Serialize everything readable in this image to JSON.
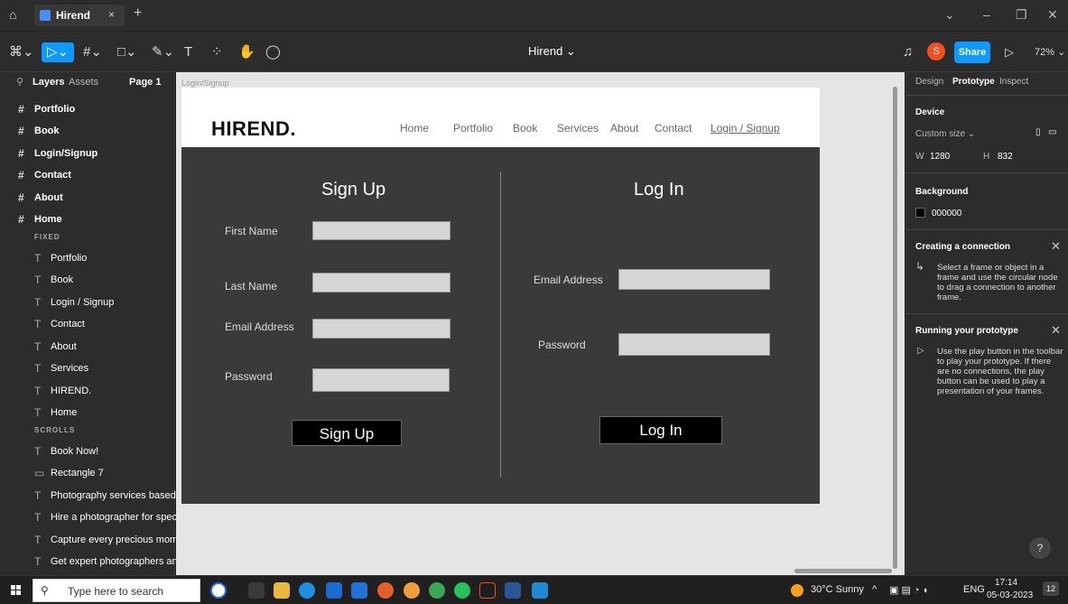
{
  "titlebar": {
    "tab_label": "Hirend",
    "tab_close": "×",
    "new_tab": "+",
    "min": "–",
    "restore": "❐",
    "close": "✕"
  },
  "toolbar": {
    "file_name": "Hirend",
    "file_caret": "⌄",
    "avatar_initial": "S",
    "share_label": "Share",
    "zoom": "72%"
  },
  "left_panel": {
    "tab_layers": "Layers",
    "tab_assets": "Assets",
    "page_label": "Page 1",
    "frames": [
      {
        "label": "Portfolio"
      },
      {
        "label": "Book"
      },
      {
        "label": "Login/Signup"
      },
      {
        "label": "Contact"
      },
      {
        "label": "About"
      },
      {
        "label": "Home"
      }
    ],
    "section_fixed": "FIXED",
    "fixed_items": [
      {
        "label": "Portfolio"
      },
      {
        "label": "Book"
      },
      {
        "label": "Login / Signup"
      },
      {
        "label": "Contact"
      },
      {
        "label": "About"
      },
      {
        "label": "Services"
      },
      {
        "label": "HIREND."
      },
      {
        "label": "Home"
      }
    ],
    "section_scrolls": "SCROLLS",
    "scroll_items": [
      {
        "label": "Book Now!"
      },
      {
        "label": "Rectangle 7"
      },
      {
        "label": "Photography services based ..."
      },
      {
        "label": "Hire a photographer for speci..."
      },
      {
        "label": "Capture every precious mome..."
      },
      {
        "label": "Get expert photographers an..."
      }
    ]
  },
  "canvas": {
    "frame_label": "Login/Signup",
    "site": {
      "logo": "HIREND.",
      "nav": [
        "Home",
        "Portfolio",
        "Book",
        "Services",
        "About",
        "Contact",
        "Login / Signup"
      ],
      "signup": {
        "heading": "Sign Up",
        "first_name": "First Name",
        "last_name": "Last Name",
        "email": "Email Address",
        "password": "Password",
        "button": "Sign Up"
      },
      "login": {
        "heading": "Log In",
        "email": "Email Address",
        "password": "Password",
        "button": "Log In"
      }
    }
  },
  "right_panel": {
    "tab_design": "Design",
    "tab_prototype": "Prototype",
    "tab_inspect": "Inspect",
    "device_heading": "Device",
    "device_value": "Custom size",
    "w_label": "W",
    "w_value": "1280",
    "h_label": "H",
    "h_value": "832",
    "background_heading": "Background",
    "background_value": "000000",
    "background_color": "#000000",
    "connection_heading": "Creating a connection",
    "connection_text": "Select a frame or object in a frame and use the circular node to drag a connection to another frame.",
    "prototype_heading": "Running your prototype",
    "prototype_text": "Use the play button in the toolbar to play your prototype. If there are no connections, the play button can be used to play a presentation of your frames.",
    "help": "?"
  },
  "taskbar": {
    "search_placeholder": "Type here to search",
    "weather": "30°C  Sunny",
    "lang": "ENG",
    "time": "17:14",
    "date": "05-03-2023",
    "notif_count": "12"
  }
}
